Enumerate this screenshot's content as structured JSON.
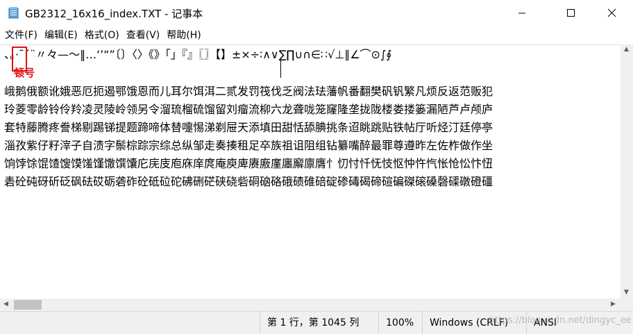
{
  "window": {
    "title": "GB2312_16x16_index.TXT - 记事本",
    "minimize_icon": "minimize-icon",
    "maximize_icon": "maximize-icon",
    "close_icon": "close-icon"
  },
  "menu": {
    "items": [
      "文件(F)",
      "编辑(E)",
      "格式(O)",
      "查看(V)",
      "帮助(H)"
    ]
  },
  "editor": {
    "lines": [
      "、。·ˉˇ¨〃々—～‖…‘’“”〔〕〈〉《》「」『』〖〗【】±×÷∶∧∨∑∏∪∩∈∷√⊥∥∠⌒⊙∫∮",
      "",
      "峨鹅俄额讹娥恶厄扼遏鄂饿恩而儿耳尔饵洱二贰发罚筏伐乏阀法珐藩帆番翻樊矾钒繁凡烦反返范贩犯",
      "玲菱零龄铃伶羚凌灵陵岭领另令溜琉榴硫馏留刘瘤流柳六龙聋咙笼窿隆垄拢陇楼娄搂篓漏陋芦卢颅庐",
      "套特藤腾疼誊梯剔踢锑提题蹄啼体替嚏惕涕剃屉天添填田甜恬舔腆挑条迢眺跳贴铁帖厅听烃汀廷停亭",
      "淄孜紫仔籽滓子自渍字鬃棕踪宗综总纵邹走奏揍租足卒族祖诅阻组钻纂嘴醉最罪尊遵昨左佐柞做作坐",
      "饷饽馀馄馇馊馍馐馑馓馔馕庀庑庋庖庥庠庹庵庾庳赓廒廑廛廨廪膺忄忉忖忏怃忮怄忡忤忾怅怆忪忭忸",
      "砉砼砘砑斫砭砜砝砹砺砻砟砼砥砬砣砩硎硭硖硗砦硐硇硌硪碛碓碚碇碜碡碣碲碹碥磔磙磉磬磲礅磴礓"
    ],
    "annotation": "顿号",
    "annotation_color": "#e01010"
  },
  "status": {
    "position": "第 1 行，第 1045 列",
    "zoom": "100%",
    "line_ending": "Windows (CRLF)",
    "encoding": "ANSI",
    "watermark": "https://blog.csdn.net/dingyc_ee"
  }
}
